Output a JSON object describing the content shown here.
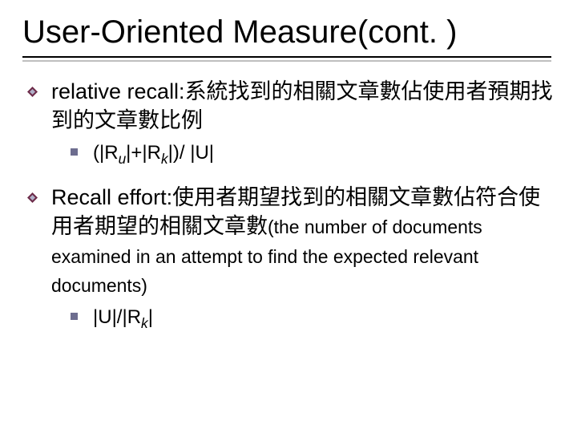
{
  "title": "User-Oriented Measure(cont. )",
  "items": [
    {
      "lead": "relative  recall:",
      "desc": "系統找到的相關文章數佔使用者預期找到的文章數比例",
      "formula": {
        "pre": "(|R",
        "s1": "u",
        "mid": "|+|R",
        "s2": "k",
        "post": "|)/ |U|"
      }
    },
    {
      "lead": "Recall effort:",
      "desc": "使用者期望找到的相關文章數佔符合使用者期望的相關文章數",
      "paren": "(the number of documents examined in an attempt to find the expected relevant documents)",
      "formula": {
        "pre": "|U|/|R",
        "s1": "k",
        "mid": "",
        "s2": "",
        "post": "|"
      }
    }
  ]
}
